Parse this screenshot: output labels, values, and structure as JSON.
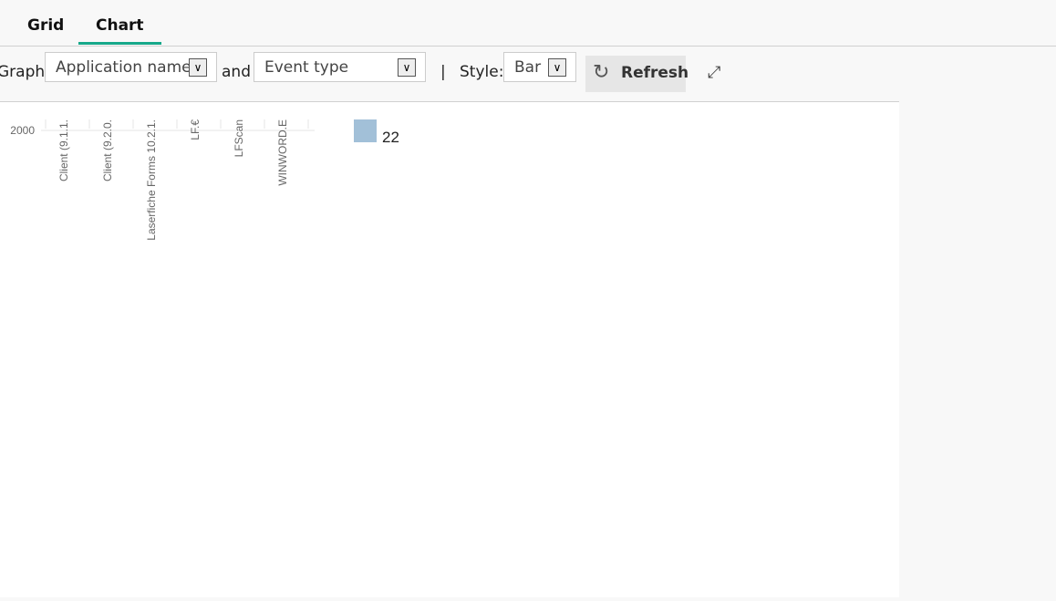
{
  "tabs": [
    {
      "label": "Grid"
    },
    {
      "label": "Chart",
      "active": true
    }
  ],
  "toolbar": {
    "graph_label": "Graph",
    "group1": "Application name",
    "and_label": "and",
    "group2": "Event type",
    "separator": "|",
    "style_label": "Style:",
    "style_value": "Bar",
    "refresh_label": "Refresh"
  },
  "icons": {
    "refresh": "refresh-icon",
    "expand": "expand-icon",
    "dropdown": "chevron-down-icon"
  },
  "chart_data": {
    "type": "bar",
    "categories": [
      "Client (9.1.1.",
      "Client (9.2.0.",
      "Laserfiche Forms 10.2.1.",
      "LF.€",
      "LFScan",
      "WINWORD.E"
    ],
    "y_ticks": [
      "2000"
    ],
    "legend": [
      {
        "label": "22",
        "color": "#a2c0d8"
      }
    ],
    "legend_position": "right",
    "grid": true
  }
}
